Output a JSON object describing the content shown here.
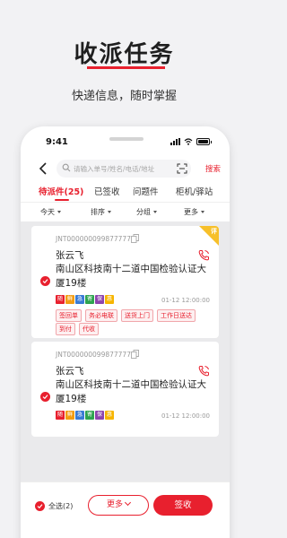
{
  "promo": {
    "title": "收派任务",
    "subtitle": "快递信息，随时掌握"
  },
  "status_bar": {
    "time": "9:41"
  },
  "search": {
    "placeholder": "请输入单号/姓名/电话/地址",
    "button_label": "搜索"
  },
  "tabs": [
    {
      "label": "待派件(25)",
      "active": true
    },
    {
      "label": "已签收",
      "active": false
    },
    {
      "label": "问题件",
      "active": false
    },
    {
      "label": "柜机/驿站",
      "active": false
    }
  ],
  "filters": [
    {
      "label": "今天"
    },
    {
      "label": "排序"
    },
    {
      "label": "分组"
    },
    {
      "label": "更多"
    }
  ],
  "cards": [
    {
      "corner_badge": "评",
      "tracking": "JNT000000099877777",
      "name": "张云飞",
      "address": "南山区科技南十二道中国检验认证大厦19楼",
      "chips": [
        {
          "text": "随",
          "color": "#e8202e"
        },
        {
          "text": "鲜",
          "color": "#f39c12"
        },
        {
          "text": "急",
          "color": "#3a7bd5"
        },
        {
          "text": "寄",
          "color": "#2ea44f"
        },
        {
          "text": "保",
          "color": "#8e44ad"
        },
        {
          "text": "惠",
          "color": "#f7b500"
        }
      ],
      "time": "01-12 12:00:00",
      "tags_row1": [
        "签回单",
        "务必电联",
        "送货上门",
        "工作日送达"
      ],
      "tags_row2": [
        "到付",
        "代收"
      ]
    },
    {
      "tracking": "JNT000000099877777",
      "name": "张云飞",
      "address": "南山区科技南十二道中国检验认证大厦19楼",
      "chips": [
        {
          "text": "随",
          "color": "#e8202e"
        },
        {
          "text": "鲜",
          "color": "#f39c12"
        },
        {
          "text": "急",
          "color": "#3a7bd5"
        },
        {
          "text": "寄",
          "color": "#2ea44f"
        },
        {
          "text": "保",
          "color": "#8e44ad"
        },
        {
          "text": "惠",
          "color": "#f7b500"
        }
      ],
      "time": "01-12 12:00:00"
    }
  ],
  "bottom_bar": {
    "select_all": "全选(2)",
    "more": "更多",
    "sign": "签收"
  },
  "colors": {
    "accent": "#e8202e",
    "badge": "#f7c02a"
  }
}
